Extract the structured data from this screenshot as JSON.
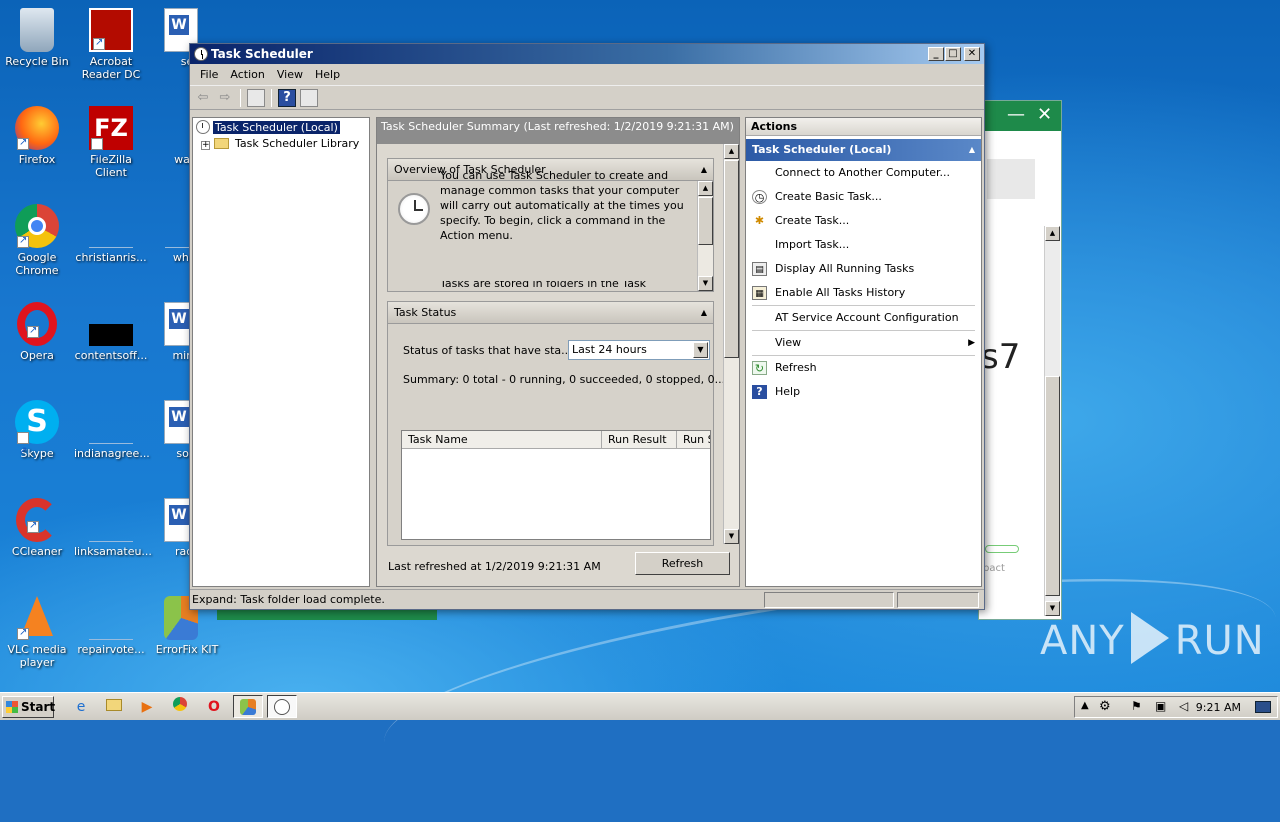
{
  "desktop": {
    "icons": [
      {
        "label": "Recycle Bin",
        "icon": "recycle-bin-icon"
      },
      {
        "label": "Acrobat Reader DC",
        "icon": "acrobat-icon"
      },
      {
        "label": "send",
        "icon": "word-doc-icon"
      },
      {
        "label": "Firefox",
        "icon": "firefox-icon"
      },
      {
        "label": "FileZilla Client",
        "icon": "filezilla-icon"
      },
      {
        "label": "watche",
        "icon": "word-doc-icon"
      },
      {
        "label": "Google Chrome",
        "icon": "chrome-icon"
      },
      {
        "label": "christianris...",
        "icon": "blank-file-icon"
      },
      {
        "label": "whoseu",
        "icon": "blank-file-icon"
      },
      {
        "label": "Opera",
        "icon": "opera-icon"
      },
      {
        "label": "contentsoff...",
        "icon": "black-file-icon"
      },
      {
        "label": "minutet",
        "icon": "word-doc-icon"
      },
      {
        "label": "Skype",
        "icon": "skype-icon"
      },
      {
        "label": "indianagree...",
        "icon": "blank-file-icon"
      },
      {
        "label": "southr",
        "icon": "word-doc-icon"
      },
      {
        "label": "CCleaner",
        "icon": "ccleaner-icon"
      },
      {
        "label": "linksamateu...",
        "icon": "blank-file-icon"
      },
      {
        "label": "radiodi",
        "icon": "word-doc-icon"
      },
      {
        "label": "VLC media player",
        "icon": "vlc-icon"
      },
      {
        "label": "repairvote...",
        "icon": "blank-file-icon"
      },
      {
        "label": "ErrorFix KIT",
        "icon": "errorfix-icon"
      }
    ],
    "background_window_text": "s7",
    "background_window_text2": "pact"
  },
  "window": {
    "title": "Task Scheduler",
    "menu": [
      "File",
      "Action",
      "View",
      "Help"
    ],
    "tree": {
      "root": "Task Scheduler (Local)",
      "child": "Task Scheduler Library"
    },
    "summary_header": "Task Scheduler Summary (Last refreshed: 1/2/2019 9:21:31 AM)",
    "overview": {
      "title": "Overview of Task Scheduler",
      "text": "You can use Task Scheduler to create and manage common tasks that your computer will carry out automatically at the times you specify. To begin, click a command in the Action menu.",
      "text2": "Tasks are stored in folders in the Task"
    },
    "task_status": {
      "title": "Task Status",
      "filter_label": "Status of tasks that have sta...",
      "filter_value": "Last 24 hours",
      "summary": "Summary: 0 total - 0 running, 0 succeeded, 0 stopped, 0...",
      "columns": [
        "Task Name",
        "Run Result",
        "Run S"
      ]
    },
    "last_refreshed": "Last refreshed at 1/2/2019 9:21:31 AM",
    "refresh_button": "Refresh",
    "actions": {
      "title": "Actions",
      "group": "Task Scheduler (Local)",
      "items": [
        {
          "label": "Connect to Another Computer...",
          "icon": ""
        },
        {
          "label": "Create Basic Task...",
          "icon": "basic-task-icon"
        },
        {
          "label": "Create Task...",
          "icon": "create-task-icon"
        },
        {
          "label": "Import Task...",
          "icon": ""
        },
        {
          "label": "Display All Running Tasks",
          "icon": "running-tasks-icon"
        },
        {
          "label": "Enable All Tasks History",
          "icon": "history-icon"
        },
        {
          "label": "AT Service Account Configuration",
          "icon": ""
        },
        {
          "label": "View",
          "icon": ""
        },
        {
          "label": "Refresh",
          "icon": "refresh-icon"
        },
        {
          "label": "Help",
          "icon": "help-icon"
        }
      ]
    },
    "status": "Expand:  Task folder load complete."
  },
  "taskbar": {
    "start": "Start",
    "clock": "9:21 AM"
  },
  "watermark": {
    "left": "ANY",
    "right": "RUN"
  }
}
